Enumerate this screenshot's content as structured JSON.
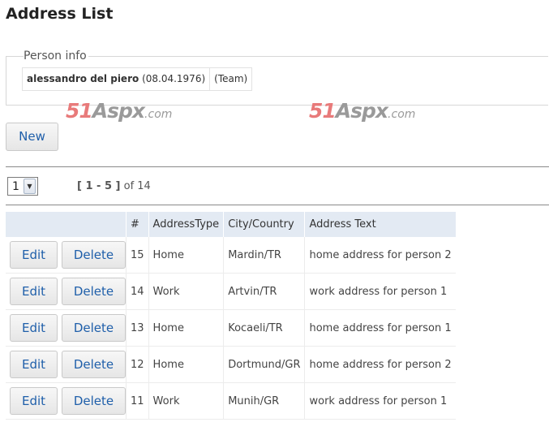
{
  "page": {
    "title": "Address List"
  },
  "person_info": {
    "legend": "Person info",
    "name": "alessandro del piero",
    "birthdate": "(08.04.1976)",
    "team": "(Team)"
  },
  "watermark": {
    "num": "51",
    "brand": "Aspx",
    "domain": ".com"
  },
  "toolbar": {
    "new_label": "New"
  },
  "pager": {
    "page_value": "1",
    "range": "[ 1 - 5 ]",
    "of_text": "of 14"
  },
  "grid": {
    "headers": {
      "actions": "",
      "num": "#",
      "type": "AddressType",
      "city": "City/Country",
      "text": "Address Text"
    },
    "edit_label": "Edit",
    "delete_label": "Delete",
    "rows": [
      {
        "id": "15",
        "type": "Home",
        "city": "Mardin/TR",
        "text": "home address for person 2"
      },
      {
        "id": "14",
        "type": "Work",
        "city": "Artvin/TR",
        "text": "work address for person 1"
      },
      {
        "id": "13",
        "type": "Home",
        "city": "Kocaeli/TR",
        "text": "home address for person 1"
      },
      {
        "id": "12",
        "type": "Home",
        "city": "Dortmund/GR",
        "text": "home address for person 2"
      },
      {
        "id": "11",
        "type": "Work",
        "city": "Munih/GR",
        "text": "work address for person 1"
      }
    ]
  }
}
